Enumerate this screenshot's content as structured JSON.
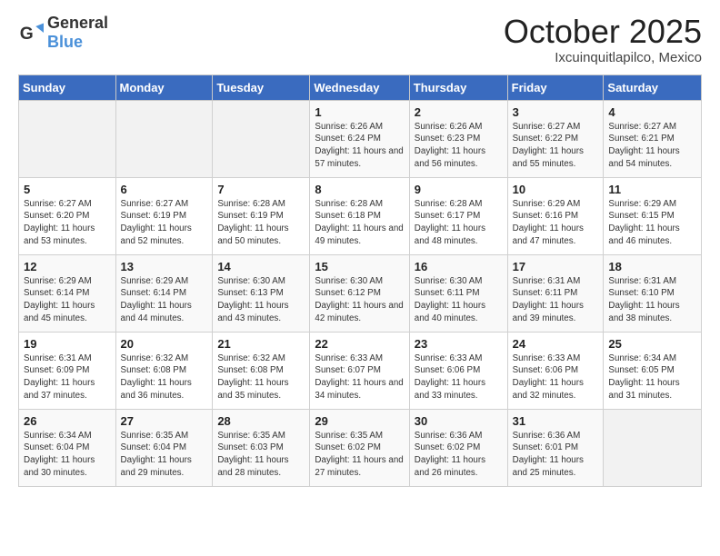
{
  "logo": {
    "general": "General",
    "blue": "Blue"
  },
  "header": {
    "month": "October 2025",
    "location": "Ixcuinquitlapilco, Mexico"
  },
  "weekdays": [
    "Sunday",
    "Monday",
    "Tuesday",
    "Wednesday",
    "Thursday",
    "Friday",
    "Saturday"
  ],
  "weeks": [
    [
      {
        "day": "",
        "sunrise": "",
        "sunset": "",
        "daylight": ""
      },
      {
        "day": "",
        "sunrise": "",
        "sunset": "",
        "daylight": ""
      },
      {
        "day": "",
        "sunrise": "",
        "sunset": "",
        "daylight": ""
      },
      {
        "day": "1",
        "sunrise": "Sunrise: 6:26 AM",
        "sunset": "Sunset: 6:24 PM",
        "daylight": "Daylight: 11 hours and 57 minutes."
      },
      {
        "day": "2",
        "sunrise": "Sunrise: 6:26 AM",
        "sunset": "Sunset: 6:23 PM",
        "daylight": "Daylight: 11 hours and 56 minutes."
      },
      {
        "day": "3",
        "sunrise": "Sunrise: 6:27 AM",
        "sunset": "Sunset: 6:22 PM",
        "daylight": "Daylight: 11 hours and 55 minutes."
      },
      {
        "day": "4",
        "sunrise": "Sunrise: 6:27 AM",
        "sunset": "Sunset: 6:21 PM",
        "daylight": "Daylight: 11 hours and 54 minutes."
      }
    ],
    [
      {
        "day": "5",
        "sunrise": "Sunrise: 6:27 AM",
        "sunset": "Sunset: 6:20 PM",
        "daylight": "Daylight: 11 hours and 53 minutes."
      },
      {
        "day": "6",
        "sunrise": "Sunrise: 6:27 AM",
        "sunset": "Sunset: 6:19 PM",
        "daylight": "Daylight: 11 hours and 52 minutes."
      },
      {
        "day": "7",
        "sunrise": "Sunrise: 6:28 AM",
        "sunset": "Sunset: 6:19 PM",
        "daylight": "Daylight: 11 hours and 50 minutes."
      },
      {
        "day": "8",
        "sunrise": "Sunrise: 6:28 AM",
        "sunset": "Sunset: 6:18 PM",
        "daylight": "Daylight: 11 hours and 49 minutes."
      },
      {
        "day": "9",
        "sunrise": "Sunrise: 6:28 AM",
        "sunset": "Sunset: 6:17 PM",
        "daylight": "Daylight: 11 hours and 48 minutes."
      },
      {
        "day": "10",
        "sunrise": "Sunrise: 6:29 AM",
        "sunset": "Sunset: 6:16 PM",
        "daylight": "Daylight: 11 hours and 47 minutes."
      },
      {
        "day": "11",
        "sunrise": "Sunrise: 6:29 AM",
        "sunset": "Sunset: 6:15 PM",
        "daylight": "Daylight: 11 hours and 46 minutes."
      }
    ],
    [
      {
        "day": "12",
        "sunrise": "Sunrise: 6:29 AM",
        "sunset": "Sunset: 6:14 PM",
        "daylight": "Daylight: 11 hours and 45 minutes."
      },
      {
        "day": "13",
        "sunrise": "Sunrise: 6:29 AM",
        "sunset": "Sunset: 6:14 PM",
        "daylight": "Daylight: 11 hours and 44 minutes."
      },
      {
        "day": "14",
        "sunrise": "Sunrise: 6:30 AM",
        "sunset": "Sunset: 6:13 PM",
        "daylight": "Daylight: 11 hours and 43 minutes."
      },
      {
        "day": "15",
        "sunrise": "Sunrise: 6:30 AM",
        "sunset": "Sunset: 6:12 PM",
        "daylight": "Daylight: 11 hours and 42 minutes."
      },
      {
        "day": "16",
        "sunrise": "Sunrise: 6:30 AM",
        "sunset": "Sunset: 6:11 PM",
        "daylight": "Daylight: 11 hours and 40 minutes."
      },
      {
        "day": "17",
        "sunrise": "Sunrise: 6:31 AM",
        "sunset": "Sunset: 6:11 PM",
        "daylight": "Daylight: 11 hours and 39 minutes."
      },
      {
        "day": "18",
        "sunrise": "Sunrise: 6:31 AM",
        "sunset": "Sunset: 6:10 PM",
        "daylight": "Daylight: 11 hours and 38 minutes."
      }
    ],
    [
      {
        "day": "19",
        "sunrise": "Sunrise: 6:31 AM",
        "sunset": "Sunset: 6:09 PM",
        "daylight": "Daylight: 11 hours and 37 minutes."
      },
      {
        "day": "20",
        "sunrise": "Sunrise: 6:32 AM",
        "sunset": "Sunset: 6:08 PM",
        "daylight": "Daylight: 11 hours and 36 minutes."
      },
      {
        "day": "21",
        "sunrise": "Sunrise: 6:32 AM",
        "sunset": "Sunset: 6:08 PM",
        "daylight": "Daylight: 11 hours and 35 minutes."
      },
      {
        "day": "22",
        "sunrise": "Sunrise: 6:33 AM",
        "sunset": "Sunset: 6:07 PM",
        "daylight": "Daylight: 11 hours and 34 minutes."
      },
      {
        "day": "23",
        "sunrise": "Sunrise: 6:33 AM",
        "sunset": "Sunset: 6:06 PM",
        "daylight": "Daylight: 11 hours and 33 minutes."
      },
      {
        "day": "24",
        "sunrise": "Sunrise: 6:33 AM",
        "sunset": "Sunset: 6:06 PM",
        "daylight": "Daylight: 11 hours and 32 minutes."
      },
      {
        "day": "25",
        "sunrise": "Sunrise: 6:34 AM",
        "sunset": "Sunset: 6:05 PM",
        "daylight": "Daylight: 11 hours and 31 minutes."
      }
    ],
    [
      {
        "day": "26",
        "sunrise": "Sunrise: 6:34 AM",
        "sunset": "Sunset: 6:04 PM",
        "daylight": "Daylight: 11 hours and 30 minutes."
      },
      {
        "day": "27",
        "sunrise": "Sunrise: 6:35 AM",
        "sunset": "Sunset: 6:04 PM",
        "daylight": "Daylight: 11 hours and 29 minutes."
      },
      {
        "day": "28",
        "sunrise": "Sunrise: 6:35 AM",
        "sunset": "Sunset: 6:03 PM",
        "daylight": "Daylight: 11 hours and 28 minutes."
      },
      {
        "day": "29",
        "sunrise": "Sunrise: 6:35 AM",
        "sunset": "Sunset: 6:02 PM",
        "daylight": "Daylight: 11 hours and 27 minutes."
      },
      {
        "day": "30",
        "sunrise": "Sunrise: 6:36 AM",
        "sunset": "Sunset: 6:02 PM",
        "daylight": "Daylight: 11 hours and 26 minutes."
      },
      {
        "day": "31",
        "sunrise": "Sunrise: 6:36 AM",
        "sunset": "Sunset: 6:01 PM",
        "daylight": "Daylight: 11 hours and 25 minutes."
      },
      {
        "day": "",
        "sunrise": "",
        "sunset": "",
        "daylight": ""
      }
    ]
  ]
}
